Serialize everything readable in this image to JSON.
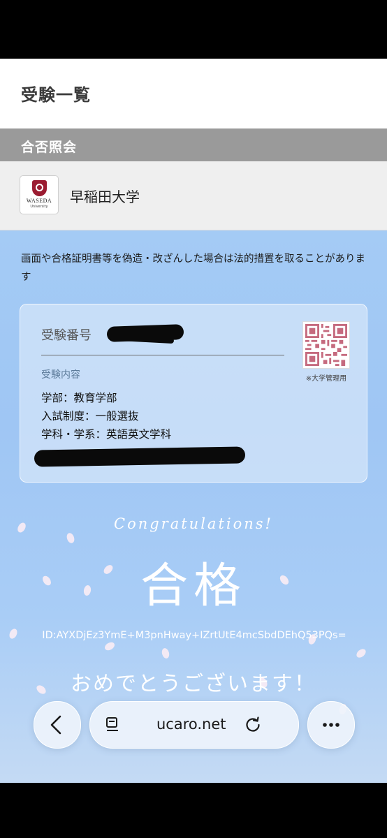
{
  "header": {
    "title": "受験一覧"
  },
  "section": {
    "title": "合否照会"
  },
  "university": {
    "name": "早稲田大学",
    "logo_text": "WASEDA",
    "logo_subtext": "University"
  },
  "notice": "画面や合格証明書等を偽造・改ざんした場合は法的措置を取ることがあります",
  "card": {
    "exam_number_label": "受験番号",
    "qr_caption": "※大学管理用",
    "details_heading": "受験内容",
    "faculty": "学部：教育学部",
    "admission_system": "入試制度：一般選抜",
    "department": "学科・学系：英語英文学科"
  },
  "result": {
    "congrats": "Congratulations!",
    "status": "合格",
    "id": "ID:AYXDjEz3YmE+M3pnHway+IZrtUtE4mcSbdDEhQ53PQs=",
    "message": "おめでとうございます！"
  },
  "browser": {
    "url": "ucaro.net",
    "back_icon": "chevron-left-icon",
    "reader_icon": "reader-mode-icon",
    "reload_icon": "reload-icon",
    "more_icon": "more-dots-icon"
  },
  "colors": {
    "accent_bg": "#a4cbf5",
    "section_bar": "#9a9a9a",
    "waseda_red": "#9b1c31"
  }
}
